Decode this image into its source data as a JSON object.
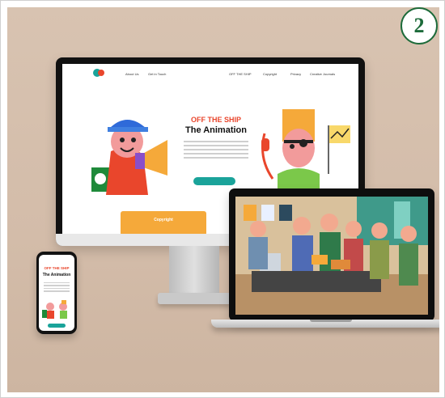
{
  "badge": {
    "number": "2"
  },
  "desktop_site": {
    "nav": {
      "links": [
        "About Us",
        "Get in Touch",
        "OFF THE SHIP",
        "Copyright",
        "Privacy",
        "Creative Journals"
      ]
    },
    "hero": {
      "kicker": "OFF THE SHIP",
      "title": "The Animation"
    },
    "cards": [
      {
        "label": "Copyright"
      }
    ]
  },
  "mobile_site": {
    "kicker": "OFF THE SHIP",
    "title": "The Animation"
  },
  "colors": {
    "accent_red": "#e9462c",
    "accent_teal": "#1aa39a",
    "accent_orange": "#f5a93a",
    "badge_green": "#1d6b3a",
    "backdrop": "#d6c0ad"
  }
}
